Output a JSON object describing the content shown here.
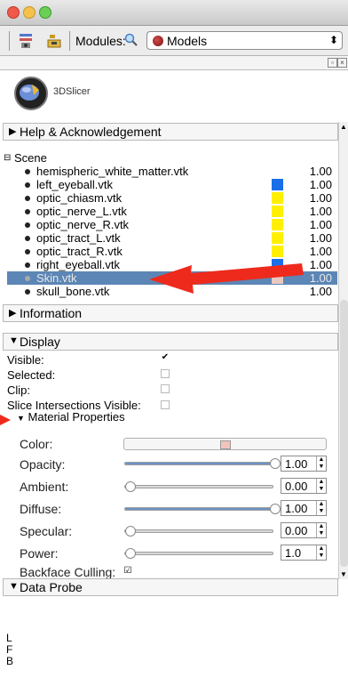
{
  "toolbar": {
    "modules_label": "Modules:",
    "selected_module": "Models"
  },
  "logo": {
    "text": "3DSlicer"
  },
  "sections": {
    "help": "Help & Acknowledgement",
    "information": "Information",
    "display": "Display",
    "data_probe": "Data Probe"
  },
  "scene": {
    "root_label": "Scene",
    "items": [
      {
        "name": "hemispheric_white_matter.vtk",
        "opacity": "1.00",
        "color": ""
      },
      {
        "name": "left_eyeball.vtk",
        "opacity": "1.00",
        "color": "#1a6fe8"
      },
      {
        "name": "optic_chiasm.vtk",
        "opacity": "1.00",
        "color": "#ffef00"
      },
      {
        "name": "optic_nerve_L.vtk",
        "opacity": "1.00",
        "color": "#ffef00"
      },
      {
        "name": "optic_nerve_R.vtk",
        "opacity": "1.00",
        "color": "#ffef00"
      },
      {
        "name": "optic_tract_L.vtk",
        "opacity": "1.00",
        "color": "#ffef00"
      },
      {
        "name": "optic_tract_R.vtk",
        "opacity": "1.00",
        "color": "#ffef00"
      },
      {
        "name": "right_eyeball.vtk",
        "opacity": "1.00",
        "color": "#1a6fe8"
      },
      {
        "name": "Skin.vtk",
        "opacity": "1.00",
        "color": "#e9c8c0",
        "selected": true
      },
      {
        "name": "skull_bone.vtk",
        "opacity": "1.00",
        "color": ""
      }
    ]
  },
  "display": {
    "visible_label": "Visible:",
    "selected_label": "Selected:",
    "clip_label": "Clip:",
    "slice_intersections_label": "Slice Intersections Visible:",
    "visible_checked": true,
    "material_properties_label": "Material Properties",
    "color_label": "Color:",
    "skin_color": "#f3c4bd",
    "opacity_label": "Opacity:",
    "opacity_value": "1.00",
    "ambient_label": "Ambient:",
    "ambient_value": "0.00",
    "diffuse_label": "Diffuse:",
    "diffuse_value": "1.00",
    "specular_label": "Specular:",
    "specular_value": "0.00",
    "power_label": "Power:",
    "power_value": "1.0",
    "backface_label": "Backface Culling:",
    "backface_checked": true
  },
  "orientation": {
    "l": "L",
    "f": "F",
    "b": "B"
  },
  "colors": {
    "selection": "#5c86b5",
    "annotation_arrow": "#ee2a1c"
  }
}
